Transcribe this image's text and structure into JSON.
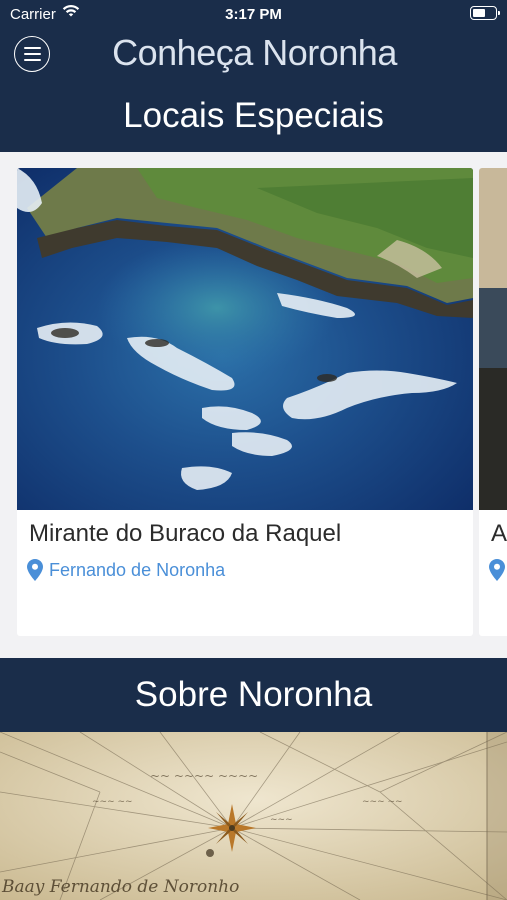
{
  "status_bar": {
    "carrier": "Carrier",
    "time": "3:17 PM"
  },
  "header": {
    "menu_icon": "hamburger-menu-icon",
    "title": "Conheça Noronha"
  },
  "section_special": {
    "title": "Locais Especiais"
  },
  "places": [
    {
      "name": "Mirante do Buraco da Raquel",
      "location": "Fernando de Noronha",
      "location_icon": "map-pin-icon"
    },
    {
      "name": "A",
      "location_icon": "map-pin-icon"
    }
  ],
  "section_about": {
    "title": "Sobre Noronha",
    "map_text": "Baay Fernando de Noronho"
  },
  "colors": {
    "header_bg": "#1a2d4a",
    "accent_blue": "#4a8fd8",
    "page_bg": "#f2f2f4"
  }
}
